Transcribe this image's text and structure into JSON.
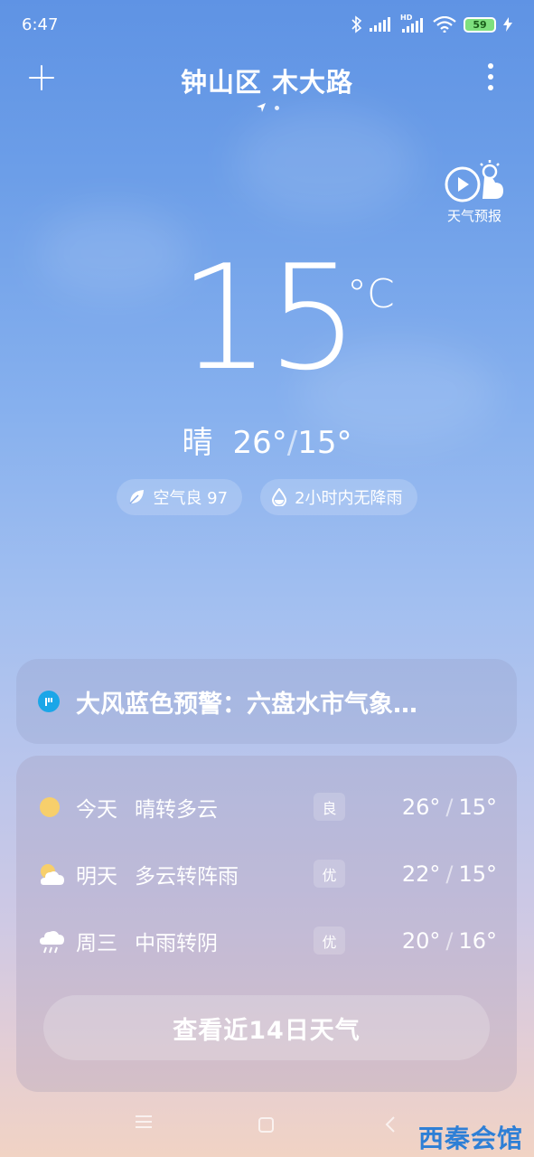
{
  "status_bar": {
    "time": "6:47",
    "network_label": "HD",
    "battery": "59"
  },
  "header": {
    "location": "钟山区 木大路"
  },
  "forecast_video": {
    "label": "天气预报"
  },
  "current": {
    "temperature": "15",
    "unit": "°C",
    "condition": "晴",
    "high": "26°",
    "low": "15°",
    "separator": "/"
  },
  "chips": [
    {
      "icon": "leaf-icon",
      "label": "空气良 97"
    },
    {
      "icon": "water-drop-icon",
      "label": "2小时内无降雨"
    }
  ],
  "alert": {
    "text": "大风蓝色预警：六盘水市气象…",
    "icon_color": "#1ba6e8"
  },
  "forecast": {
    "days": [
      {
        "day": "今天",
        "condition": "晴转多云",
        "aqi": "良",
        "high": "26°",
        "low": "15°",
        "icon": "sun-icon"
      },
      {
        "day": "明天",
        "condition": "多云转阵雨",
        "aqi": "优",
        "high": "22°",
        "low": "15°",
        "icon": "partly-cloudy-icon"
      },
      {
        "day": "周三",
        "condition": "中雨转阴",
        "aqi": "优",
        "high": "20°",
        "low": "16°",
        "icon": "rain-cloud-icon"
      }
    ],
    "separator": "/",
    "more_button": "查看近14日天气"
  },
  "watermark": "西秦会馆"
}
